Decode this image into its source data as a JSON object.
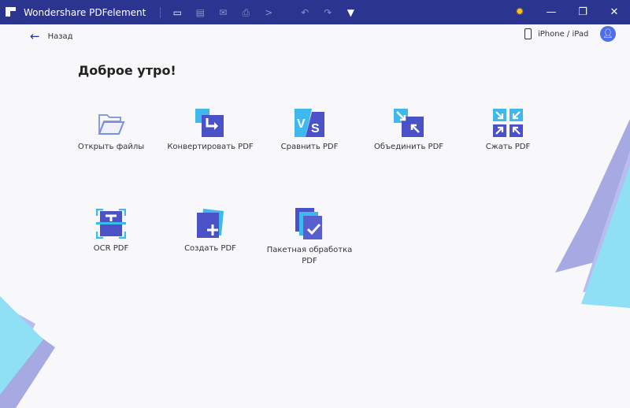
{
  "titlebar": {
    "app_title": "Wondershare PDFelement",
    "icons": [
      "folder-icon",
      "save-icon",
      "mail-icon",
      "print-icon",
      "share-icon",
      "undo-icon",
      "redo-icon",
      "dropdown-icon"
    ]
  },
  "nav": {
    "back_label": "Назад",
    "device_label": "iPhone / iPad"
  },
  "main": {
    "greeting": "Доброе утро!",
    "tools": [
      {
        "label": "Открыть файлы",
        "icon": "folder-open-icon"
      },
      {
        "label": "Конвертировать PDF",
        "icon": "convert-icon"
      },
      {
        "label": "Сравнить PDF",
        "icon": "compare-icon"
      },
      {
        "label": "Объединить PDF",
        "icon": "merge-icon"
      },
      {
        "label": "Сжать PDF",
        "icon": "compress-icon"
      },
      {
        "label": "OCR PDF",
        "icon": "ocr-icon"
      },
      {
        "label": "Создать PDF",
        "icon": "create-icon"
      },
      {
        "label": "Пакетная обработка PDF",
        "icon": "batch-icon"
      }
    ]
  },
  "colors": {
    "titlebar": "#2b3590",
    "accent": "#4f6de8"
  }
}
